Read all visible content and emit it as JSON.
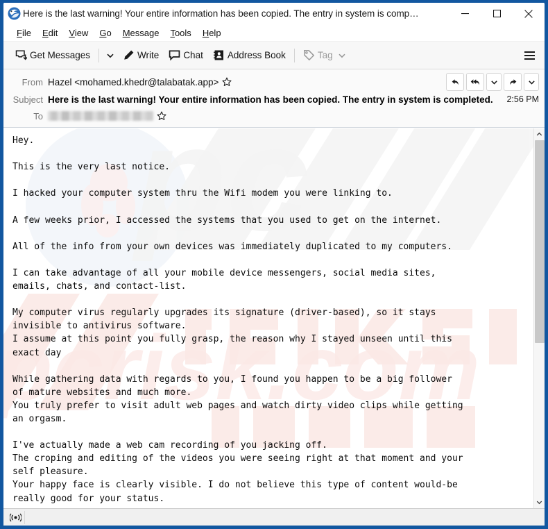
{
  "window": {
    "title": "Here is the last warning! Your entire information has been copied. The entry in system is comp…",
    "app_icon": "thunderbird-icon",
    "minimize_label": "−",
    "maximize_label": "□",
    "close_label": "×",
    "accent_color": "#1257a0"
  },
  "menubar": {
    "items": [
      {
        "label": "File",
        "accesskey": "F"
      },
      {
        "label": "Edit",
        "accesskey": "E"
      },
      {
        "label": "View",
        "accesskey": "V"
      },
      {
        "label": "Go",
        "accesskey": "G"
      },
      {
        "label": "Message",
        "accesskey": "M"
      },
      {
        "label": "Tools",
        "accesskey": "T"
      },
      {
        "label": "Help",
        "accesskey": "H"
      }
    ]
  },
  "toolbar": {
    "get_messages_label": "Get Messages",
    "get_messages_icon": "download-inbox-icon",
    "get_messages_chevron_icon": "chevron-down-icon",
    "write_label": "Write",
    "write_icon": "pencil-icon",
    "chat_label": "Chat",
    "chat_icon": "speech-bubble-icon",
    "address_book_label": "Address Book",
    "address_book_icon": "contact-card-icon",
    "tag_label": "Tag",
    "tag_icon": "tag-icon",
    "tag_chevron_icon": "chevron-down-icon",
    "tag_disabled": true,
    "hamburger_icon": "hamburger-menu-icon"
  },
  "message_header": {
    "from_label": "From",
    "from_value": "Hazel <mohamed.khedr@talabatak.app>",
    "from_star_icon": "star-outline-icon",
    "subject_label": "Subject",
    "subject_value": "Here is the last warning! Your entire information has been copied. The entry in system is completed.",
    "time_value": "2:56 PM",
    "to_label": "To",
    "to_value": "",
    "to_redacted": true,
    "to_star_icon": "star-outline-icon",
    "actions": [
      {
        "name": "reply-button",
        "icon": "reply-arrow-icon"
      },
      {
        "name": "reply-all-button",
        "icon": "reply-all-arrow-icon"
      },
      {
        "name": "reply-more-button",
        "icon": "chevron-down-icon"
      },
      {
        "name": "forward-button",
        "icon": "forward-arrow-icon"
      },
      {
        "name": "forward-more-button",
        "icon": "chevron-down-icon"
      }
    ]
  },
  "body": {
    "watermark_text": "pcrisk.com",
    "text": "Hey.\n\nThis is the very last notice.\n\nI hacked your computer system thru the Wifi modem you were linking to.\n\nA few weeks prior, I accessed the systems that you used to get on the internet.\n\nAll of the info from your own devices was immediately duplicated to my computers.\n\nI can take advantage of all your mobile device messengers, social media sites,\nemails, chats, and contact-list.\n\nMy computer virus regularly upgrades its signature (driver-based), so it stays\ninvisible to antivirus software.\nI assume at this point you fully grasp, the reason why I stayed unseen until this\nexact day\n\nWhile gathering data with regards to you, I found you happen to be a big follower\nof mature websites and much more.\nYou truly prefer to visit adult web pages and watch dirty video clips while getting\nan orgasm.\n\nI've actually made a web cam recording of you jacking off.\nThe croping and editing of the videos you were seeing right at that moment and your\nself pleasure.\nYour happy face is clearly visible. I do not believe this type of content would-be\nreally good for your status."
  },
  "scrollbar": {
    "up_arrow_icon": "chevron-up-icon",
    "down_arrow_icon": "chevron-down-icon",
    "thumb_position_percent": 0,
    "thumb_size_percent": 57
  },
  "statusbar": {
    "icon": "broadcast-online-icon",
    "text": ""
  }
}
